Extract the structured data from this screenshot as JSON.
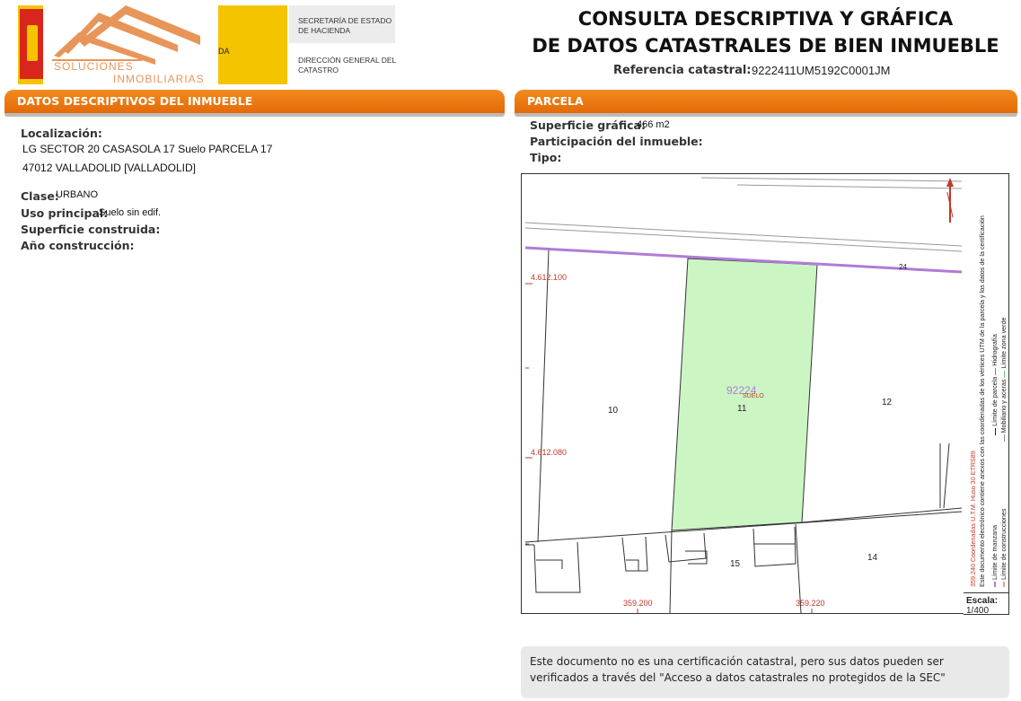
{
  "header": {
    "logo_tail_text": "DA",
    "ministry_line1": "SECRETARÍA DE ESTADO DE HACIENDA",
    "ministry_line2": "DIRECCIÓN GENERAL DEL CATASTRO",
    "brand_line1": "SOLUCIONES",
    "brand_line2": "INMOBILIARIAS",
    "title_line1": "CONSULTA DESCRIPTIVA Y GRÁFICA",
    "title_line2": "DE DATOS CATASTRALES DE BIEN INMUEBLE",
    "ref_label": "Referencia catastral:",
    "ref_value": "9222411UM5192C0001JM"
  },
  "descriptivos": {
    "header": "DATOS DESCRIPTIVOS DEL INMUEBLE",
    "localizacion_label": "Localización:",
    "localizacion_line1": "LG SECTOR 20 CASASOLA 17 Suelo PARCELA 17",
    "localizacion_line2": "47012 VALLADOLID [VALLADOLID]",
    "clase_label": "Clase:",
    "clase_value": "URBANO",
    "uso_label": "Uso principal:",
    "uso_value": "Suelo sin edif.",
    "superficie_label": "Superficie construida:",
    "anio_label": "Año construcción:"
  },
  "parcela": {
    "header": "PARCELA",
    "superficie_label": "Superficie gráfica:",
    "superficie_value": "466 m2",
    "participacion_label": "Participación del inmueble:",
    "tipo_label": "Tipo:"
  },
  "plan": {
    "coord_y1": "4.612.100",
    "coord_y2": "4.612.080",
    "coord_x1": "359.200",
    "coord_x2": "359.220",
    "parcel_ref": "92224",
    "parcel_sub": "SUELO",
    "lot_10": "10",
    "lot_11": "11",
    "lot_12": "12",
    "lot_14": "14",
    "lot_15": "15",
    "lot_24": "24",
    "scale_label": "Escala:",
    "scale_value": "1/400",
    "parcel_fill": "#ccf5c4",
    "boundary_color": "#b07cd6"
  },
  "legend": {
    "coords": "359.240 Coordenadas U.T.M. Huso 30 ETRS89",
    "doc_note": "Este documento electrónico contiene anexos con las coordenadas de los vértices UTM de la parcela y los datos de la certificación",
    "manzana": "Límite de manzana",
    "parcela": "Límite de parcela",
    "hidrografia": "Hidrografía",
    "construcciones": "Límite de construcciones",
    "mobiliario": "Mobiliario y aceras",
    "zona_verde": "Límite zona verde"
  },
  "notice": "Este documento no es una certificación catastral, pero sus datos pueden ser verificados a través del \"Acceso a datos catastrales no protegidos de la SEC\""
}
